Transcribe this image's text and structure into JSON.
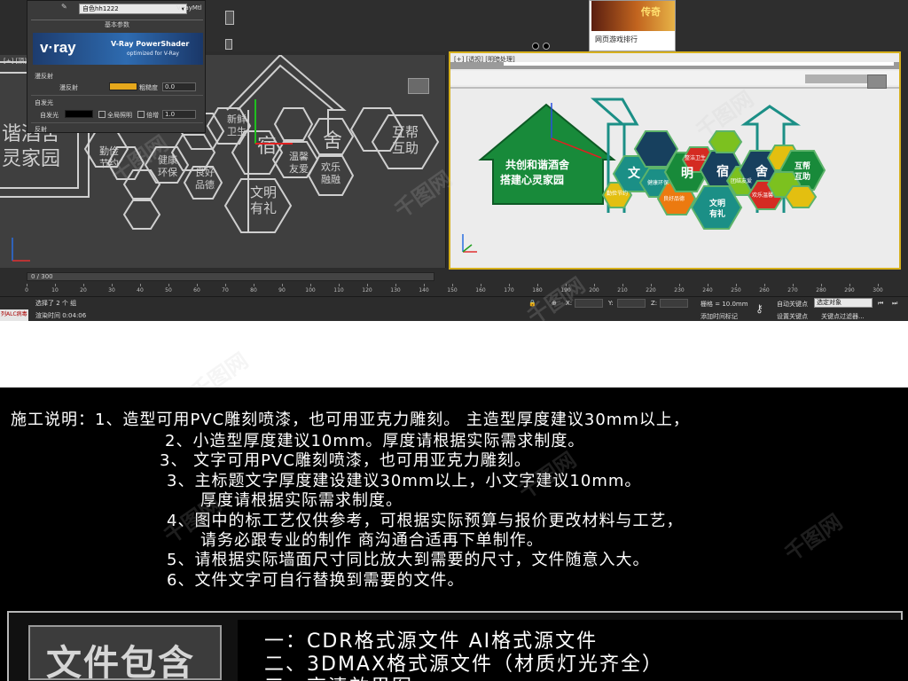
{
  "material_panel": {
    "pick_icon": "eyedropper-icon",
    "material_name": "自色hh1222",
    "material_type": "VRayMtl",
    "rollout_title": "基本参数",
    "vray_logo": "v·ray",
    "vray_product": "V-Ray PowerShader",
    "vray_sub": "optimized for V-Ray",
    "diffuse_group": "漫反射",
    "diffuse_label": "漫反射",
    "diffuse_color": "#e6a81c",
    "roughness_label": "粗糙度",
    "roughness_value": "0.0",
    "selfillum_group": "自发光",
    "selfillum_label": "自发光",
    "selfillum_color": "#000000",
    "gi_label": "全局照明",
    "multiplier_label": "倍增",
    "multiplier_value": "1.0",
    "reflect_group": "反射"
  },
  "left_viewport": {
    "label": "[+] [顶] [线框]",
    "hex_texts": [
      "勤俭节约",
      "健康环保",
      "良好品德",
      "新鲜卫生",
      "文明有礼",
      "温馨友爱",
      "欢乐融融",
      "互帮互助"
    ],
    "big_text": [
      "谐酒舍",
      "灵家园"
    ]
  },
  "right_viewport": {
    "label": "[+] [透视] [明暗处理]",
    "house_lines": [
      "共创和谐酒舍",
      "搭建心灵家园"
    ],
    "big_chars": [
      "文",
      "明",
      "宿",
      "舍"
    ],
    "small_hexes": [
      "勤俭节约",
      "健康环保",
      "良好品德",
      "整洁卫生",
      "团结友爱",
      "欢乐温馨"
    ],
    "wenming": [
      "文明",
      "有礼"
    ],
    "hubang": [
      "互帮",
      "互助"
    ]
  },
  "thumb": {
    "logo": "传奇",
    "title": "网页游戏排行"
  },
  "timeline": {
    "frame": "0 / 300",
    "ticks": [
      "0",
      "10",
      "20",
      "30",
      "40",
      "50",
      "60",
      "70",
      "80",
      "90",
      "100",
      "110",
      "120",
      "130",
      "140",
      "150",
      "160",
      "170",
      "180",
      "190",
      "200",
      "210",
      "220",
      "230",
      "240",
      "250",
      "260",
      "270",
      "280",
      "290",
      "300"
    ]
  },
  "status": {
    "maxscript": "列ALC病毒",
    "selected": "选择了 2 个 组",
    "render_time": "渲染时间 0:04:06",
    "x_label": "X:",
    "y_label": "Y:",
    "z_label": "Z:",
    "grid": "栅格 = 10.0mm",
    "add_time_tag": "添加时间标记",
    "auto_key": "自动关键点",
    "selected_obj": "选定对象",
    "set_key": "设置关键点",
    "key_filters": "关键点过滤器..."
  },
  "notes": [
    "施工说明：1、造型可用PVC雕刻喷漆，也可用亚克力雕刻。  主造型厚度建议30mm以上，",
    "2、小造型厚度建议10mm。厚度请根据实际需求制度。",
    "3、 文字可用PVC雕刻喷漆，也可用亚克力雕刻。",
    "3、主标题文字厚度建设建议30mm以上，小文字建议10mm。",
    "厚度请根据实际需求制度。",
    "4、图中的标工艺仅供参考，可根据实际预算与报价更改材料与工艺，",
    "请务必跟专业的制作 商沟通合适再下单制作。",
    "5、请根据实际墙面尺寸同比放大到需要的尺寸，文件随意入大。",
    "6、文件文字可自行替换到需要的文件。"
  ],
  "files": {
    "title": "文件包含",
    "lines": [
      "一：CDR格式源文件  AI格式源文件",
      "二、3DMAX格式源文件（材质灯光齐全）",
      "三、高清效果图"
    ]
  },
  "watermark": "千图网",
  "colors": {
    "green": "#188a3a",
    "teal": "#1b8f86",
    "navy": "#17405e",
    "red": "#d42b22",
    "orange": "#ec7a10",
    "yellow": "#e3bf10",
    "lime": "#7cc11f",
    "viewport_border": "#d6b01d"
  }
}
